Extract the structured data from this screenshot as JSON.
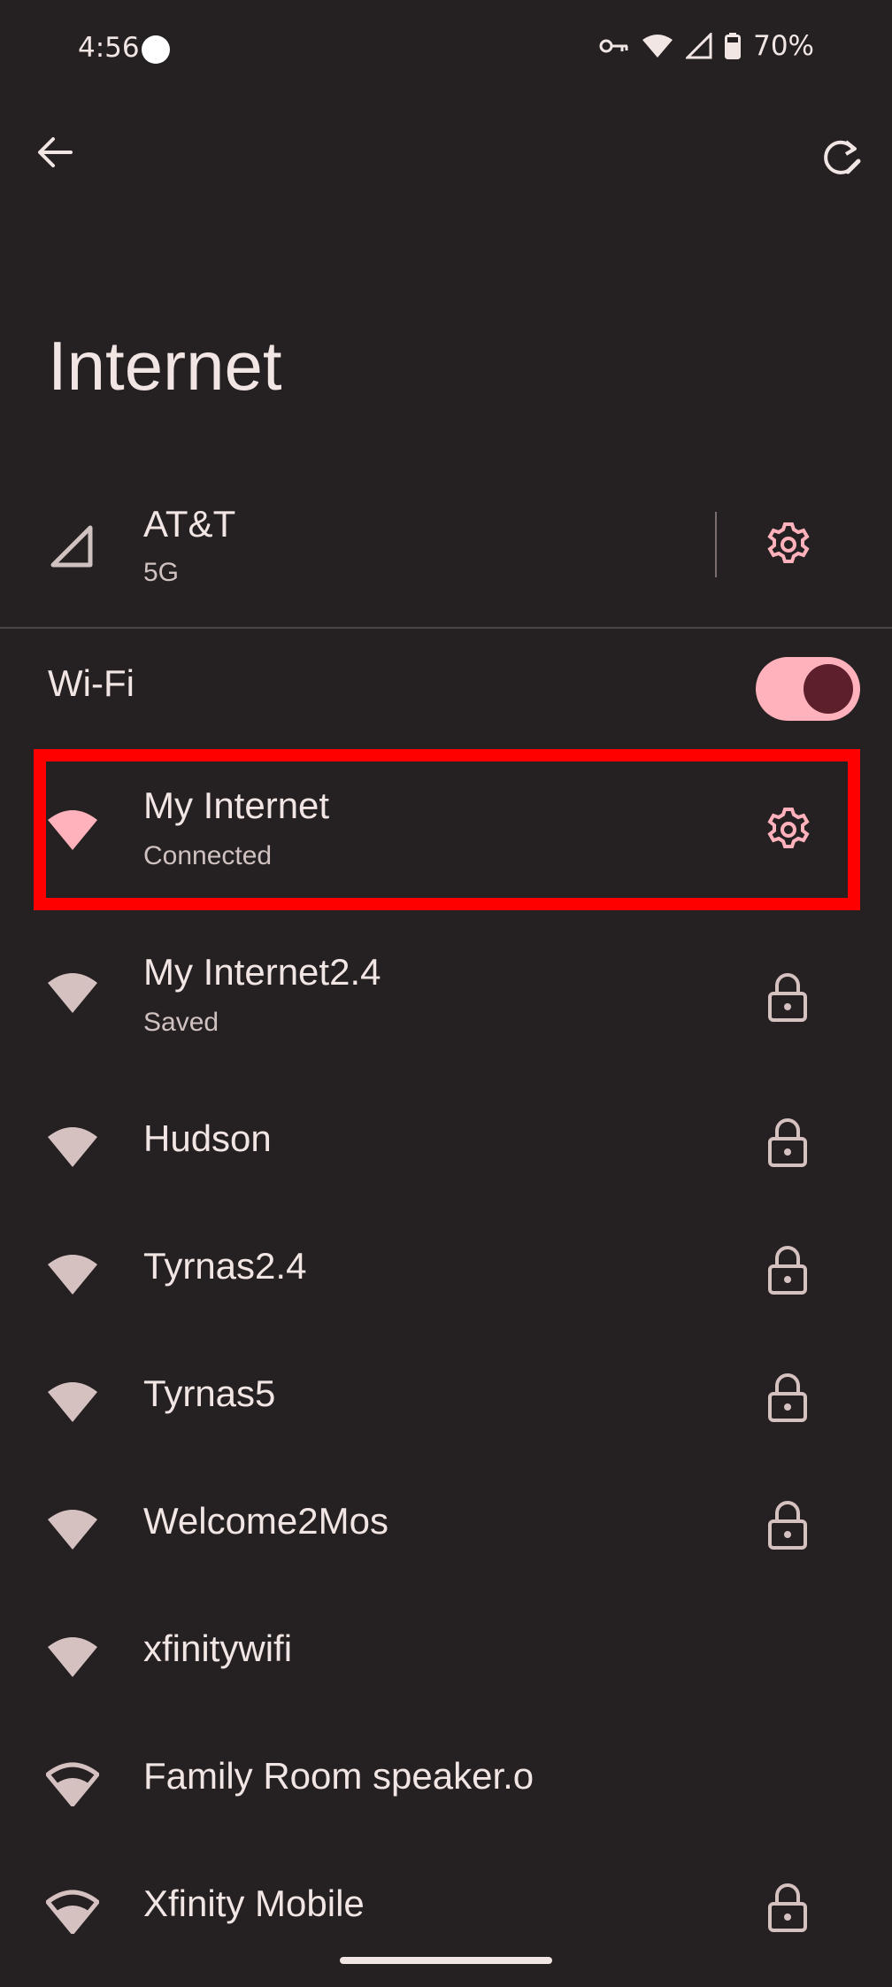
{
  "status_bar": {
    "time": "4:56",
    "battery": "70%"
  },
  "page": {
    "title": "Internet"
  },
  "carrier": {
    "name": "AT&T",
    "network_type": "5G"
  },
  "wifi": {
    "label": "Wi-Fi",
    "enabled": true
  },
  "networks": [
    {
      "name": "My Internet",
      "status": "Connected",
      "trailing": "gear-icon",
      "icon_color": "#ffb2bb"
    },
    {
      "name": "My Internet2.4",
      "status": "Saved",
      "trailing": "lock-icon"
    },
    {
      "name": "Hudson",
      "status": "",
      "trailing": "lock-icon"
    },
    {
      "name": "Tyrnas2.4",
      "status": "",
      "trailing": "lock-icon"
    },
    {
      "name": "Tyrnas5",
      "status": "",
      "trailing": "lock-icon"
    },
    {
      "name": "Welcome2Mos",
      "status": "",
      "trailing": "lock-icon"
    },
    {
      "name": "xfinitywifi",
      "status": "",
      "trailing": ""
    },
    {
      "name": "Family Room speaker.o",
      "status": "",
      "trailing": ""
    },
    {
      "name": "Xfinity Mobile",
      "status": "",
      "trailing": "lock-icon"
    }
  ],
  "colors": {
    "background": "#252021",
    "accent": "#ffb2bb",
    "highlight_box": "#ff0000"
  }
}
